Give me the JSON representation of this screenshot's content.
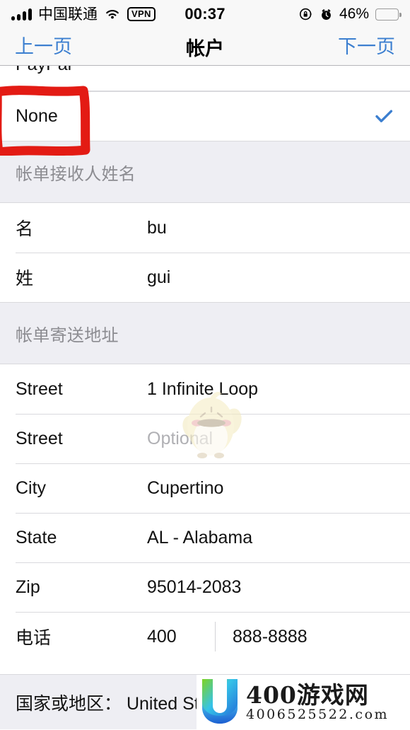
{
  "status_bar": {
    "signal_icon": "signal-bars-icon",
    "carrier": "中国联通",
    "wifi_icon": "wifi-icon",
    "vpn_badge": "VPN",
    "time": "00:37",
    "rotation_lock_icon": "rotation-lock-icon",
    "alarm_icon": "alarm-clock-icon",
    "battery_percent": "46%",
    "battery_level": 46
  },
  "nav_bar": {
    "back_label": "上一页",
    "title": "帐户",
    "next_label": "下一页",
    "accent_color": "#3c7fd0"
  },
  "payment_section": {
    "clipped_row_label": "PayPal",
    "selected_row": {
      "label": "None",
      "checkmark_icon": "checkmark-icon",
      "checkmark_color": "#3c7fd0",
      "selected": true
    }
  },
  "billing_name_section": {
    "header": "帐单接收人姓名",
    "rows": [
      {
        "label": "名",
        "value": "bu",
        "placeholder": false
      },
      {
        "label": "姓",
        "value": "gui",
        "placeholder": false
      }
    ]
  },
  "billing_address_section": {
    "header": "帐单寄送地址",
    "rows": [
      {
        "label": "Street",
        "value": "1 Infinite Loop",
        "placeholder": false
      },
      {
        "label": "Street",
        "value": "Optional",
        "placeholder": true
      },
      {
        "label": "City",
        "value": "Cupertino",
        "placeholder": false
      },
      {
        "label": "State",
        "value": "AL - Alabama",
        "placeholder": false
      },
      {
        "label": "Zip",
        "value": "95014-2083",
        "placeholder": false
      }
    ],
    "phone_row": {
      "label": "电话",
      "country_code": "400",
      "number": "888-8888"
    }
  },
  "country_bar": {
    "text": "国家或地区： United States"
  },
  "annotation": {
    "type": "hand-drawn-rectangle",
    "color": "#e31b14",
    "target": "None"
  },
  "watermarks": {
    "sticker_icon": "chick-sticker-icon",
    "brand_logo_icon": "u-shield-logo-icon",
    "brand_name": "400游戏网",
    "brand_url": "4006525522.com"
  }
}
